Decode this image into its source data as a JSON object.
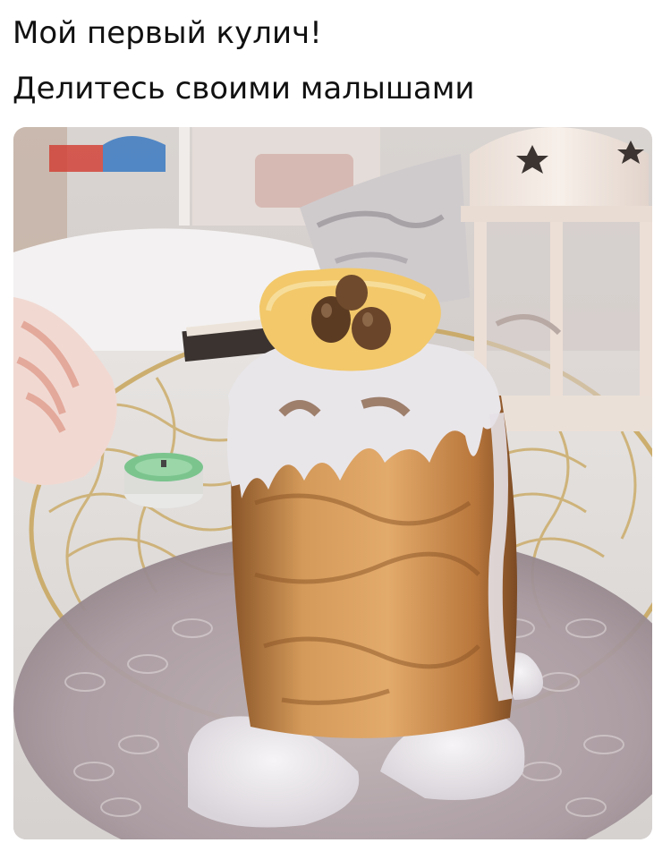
{
  "post": {
    "caption_line1": "Мой первый кулич!",
    "caption_line2": "Делитесь своими малышами"
  },
  "photo": {
    "subject": "homemade-kulich-cake-icing-photo",
    "colors": {
      "icing": "#e9e6ea",
      "crumb": "#c88a4a",
      "crust": "#7a4a22",
      "biscuit": "#f2c86a",
      "lantern": "#f3e9e2",
      "plate": "#a99aa0",
      "mesh_gold": "#c8a55a"
    }
  }
}
